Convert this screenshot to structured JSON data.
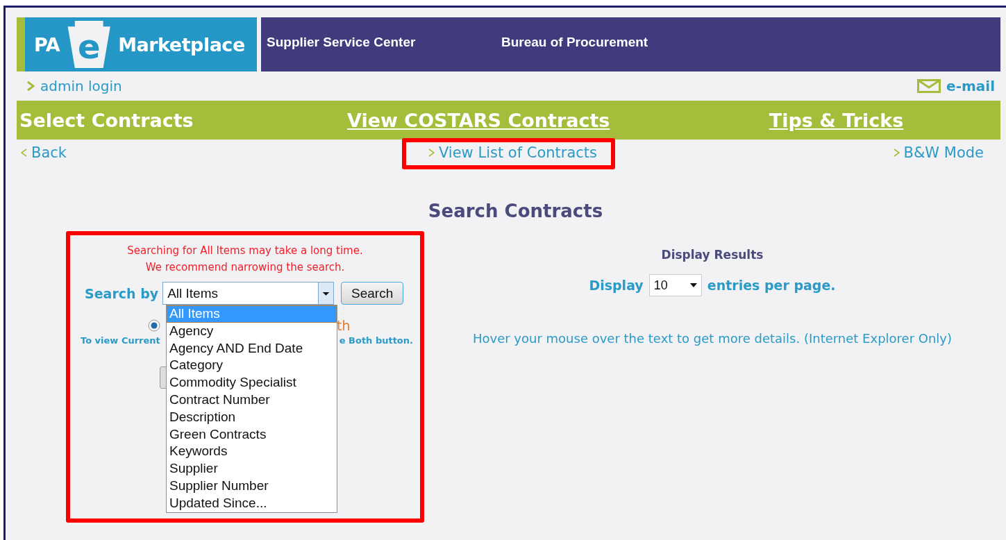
{
  "header": {
    "logo": {
      "left": "PA",
      "badge": "e",
      "right": "Marketplace"
    },
    "titles": [
      "Supplier Service Center",
      "Bureau of Procurement"
    ]
  },
  "utility_links": [
    {
      "label": "admin login",
      "kind": "chevron"
    },
    {
      "label": "e-mail",
      "kind": "mail"
    }
  ],
  "nav": [
    {
      "label": "Select Contracts",
      "underlined": false
    },
    {
      "label": "View COSTARS Contracts",
      "underlined": true
    },
    {
      "label": "Tips & Tricks",
      "underlined": true
    }
  ],
  "sub_links": [
    {
      "label": "Back",
      "kind": "back",
      "highlighted": false
    },
    {
      "label": "View List of Contracts",
      "kind": "forward",
      "highlighted": true
    },
    {
      "label": "B&W Mode",
      "kind": "forward",
      "highlighted": false
    }
  ],
  "heading": "Search Contracts",
  "search": {
    "highlighted": true,
    "warning": [
      "Searching for All Items may take a long time.",
      "We recommend narrowing the search."
    ],
    "label": "Search by",
    "select_value": "All Items",
    "button": "Search",
    "options": [
      {
        "label": "All Items",
        "selected": true
      },
      {
        "label": "Agency",
        "selected": false
      },
      {
        "label": "Agency AND End Date",
        "selected": false
      },
      {
        "label": "Category",
        "selected": false
      },
      {
        "label": "Commodity Specialist",
        "selected": false
      },
      {
        "label": "Contract Number",
        "selected": false
      },
      {
        "label": "Description",
        "selected": false
      },
      {
        "label": "Green Contracts",
        "selected": false
      },
      {
        "label": "Keywords",
        "selected": false
      },
      {
        "label": "Supplier",
        "selected": false
      },
      {
        "label": "Supplier Number",
        "selected": false
      },
      {
        "label": "Updated Since...",
        "selected": false
      }
    ],
    "radio": {
      "checked": true,
      "visible_text": "th"
    },
    "hint_fragments": [
      "To view Current",
      "e Both button."
    ]
  },
  "display": {
    "title": "Display Results",
    "prefix": "Display",
    "value": "10",
    "suffix": "entries per page.",
    "note": "Hover your mouse over the text to get more details. (Internet Explorer Only)"
  }
}
